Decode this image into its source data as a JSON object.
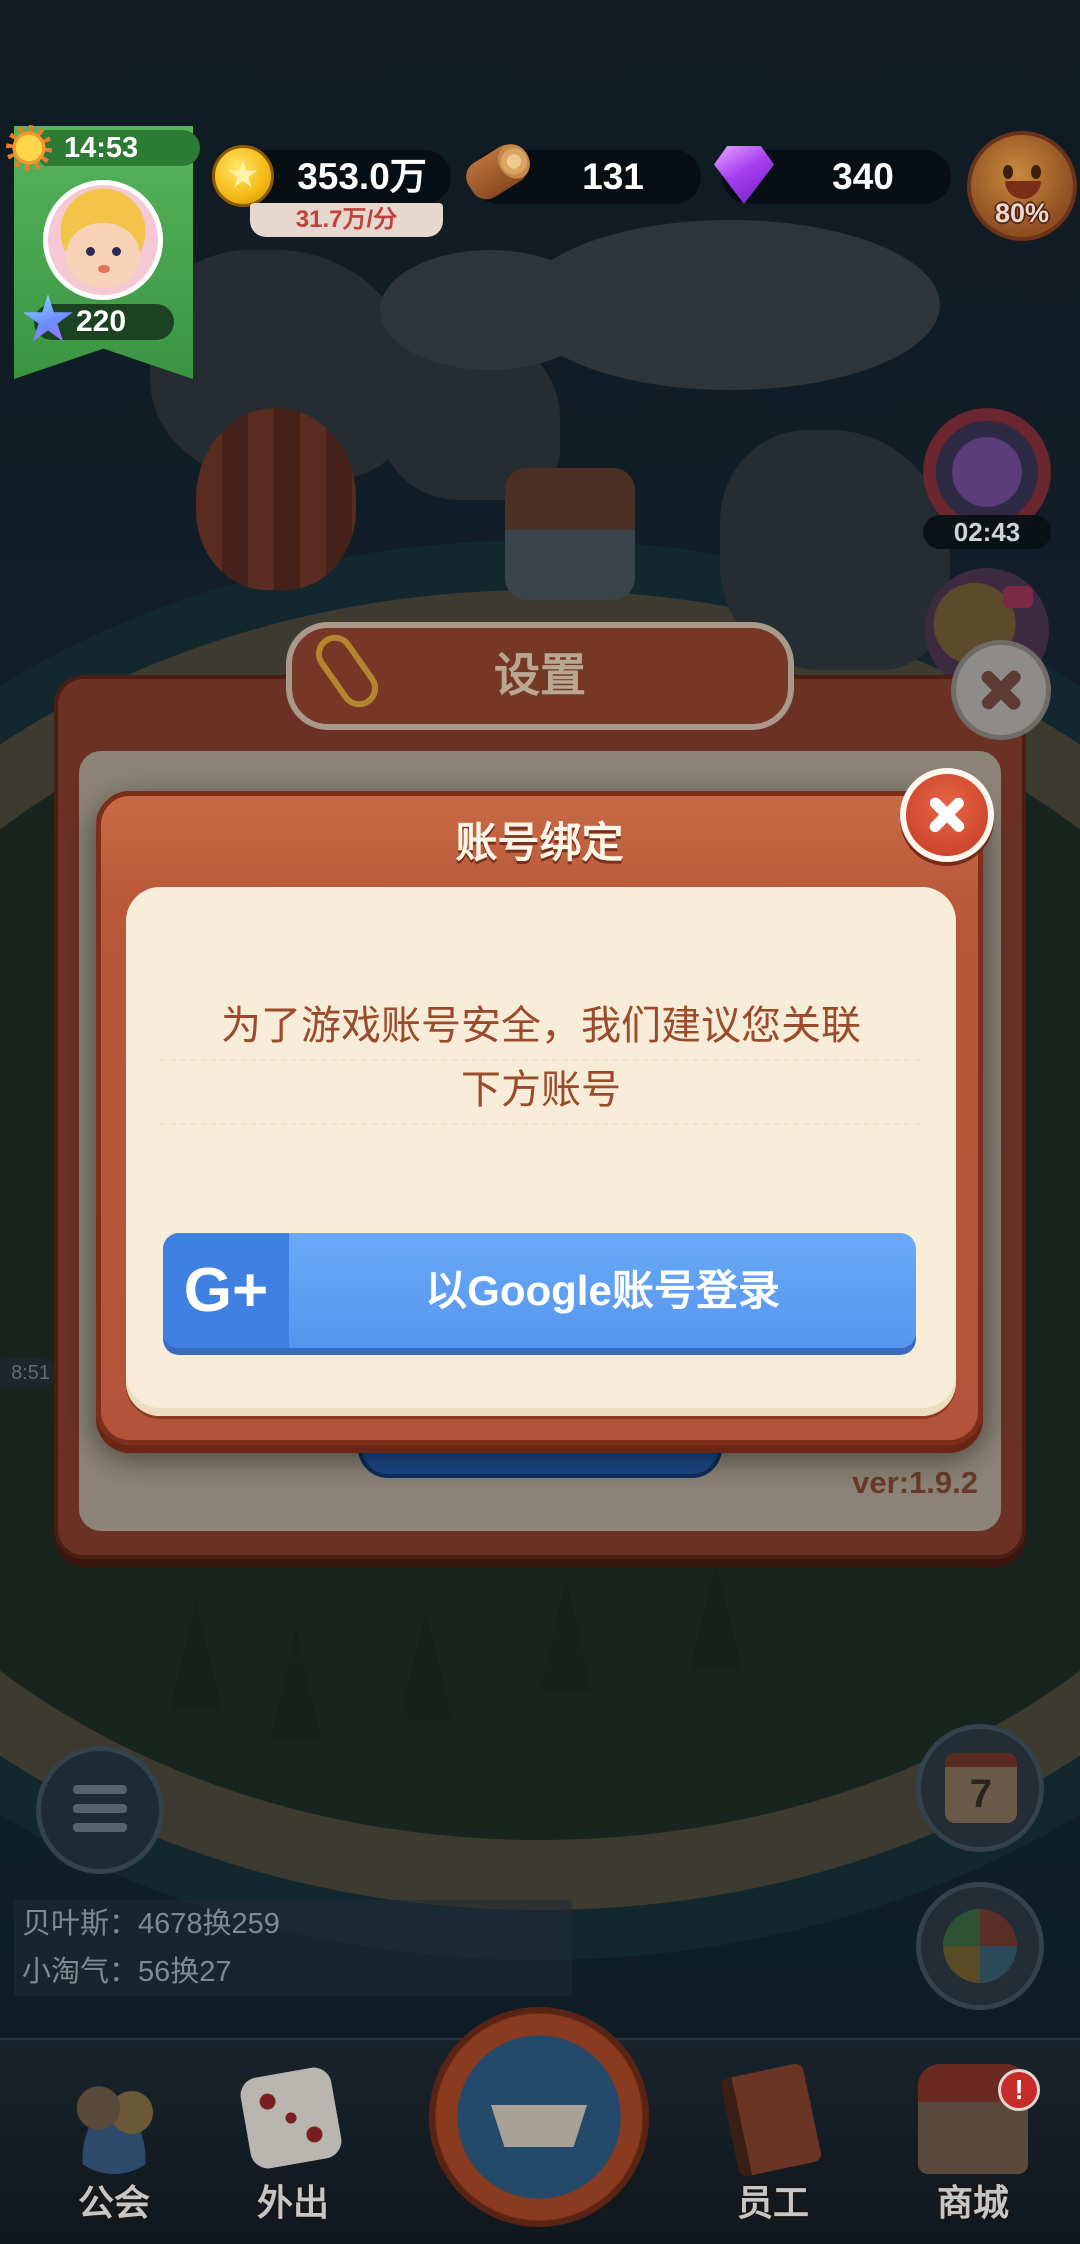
{
  "hud": {
    "time": "14:53",
    "level": "220",
    "coins": "353.0万",
    "coin_rate": "31.7万/分",
    "wood": "131",
    "gems": "340",
    "happiness": "80%"
  },
  "side": {
    "phone_timer": "02:43",
    "calendar_day": "7",
    "partial_timer": "8:51"
  },
  "settings_dialog": {
    "title": "设置",
    "version": "ver:1.9.2"
  },
  "bind_dialog": {
    "title": "账号绑定",
    "message_line1": "为了游戏账号安全，我们建议您关联",
    "message_line2": "下方账号",
    "google_logo": "G+",
    "google_button": "以Google账号登录"
  },
  "chat": [
    {
      "text": "贝叶斯：4678换259"
    },
    {
      "text": "小淘气：56换27"
    }
  ],
  "nav": [
    {
      "label": "公会",
      "icon": "guild-icon"
    },
    {
      "label": "外出",
      "icon": "dice-icon"
    },
    {
      "label": "员工",
      "icon": "staff-book-icon"
    },
    {
      "label": "商城",
      "icon": "shop-icon"
    }
  ],
  "nav_center_icon": "ship-icon",
  "shop_badge": "!",
  "icons": {
    "clock": "sun-icon",
    "level": "star-icon",
    "coins": "coin-icon",
    "wood": "wood-log-icon",
    "gems": "gem-icon",
    "happiness": "smiley-icon",
    "phone": "phone-icon",
    "video": "video-icon",
    "close": "close-icon",
    "paperclip": "paperclip-icon",
    "menu": "menu-list-icon",
    "calendar": "calendar-icon",
    "pinwheel": "pinwheel-icon"
  },
  "colors": {
    "dialog_frame": "#b3543a",
    "dialog_panel": "#f7ecd7",
    "message_text": "#9b4b2c",
    "google_button": "#5596ee",
    "google_logo_bg": "#3f80e3",
    "close_button": "#c53a24",
    "profile_flag": "#3a9440",
    "coin_rate_text": "#c0403a"
  }
}
